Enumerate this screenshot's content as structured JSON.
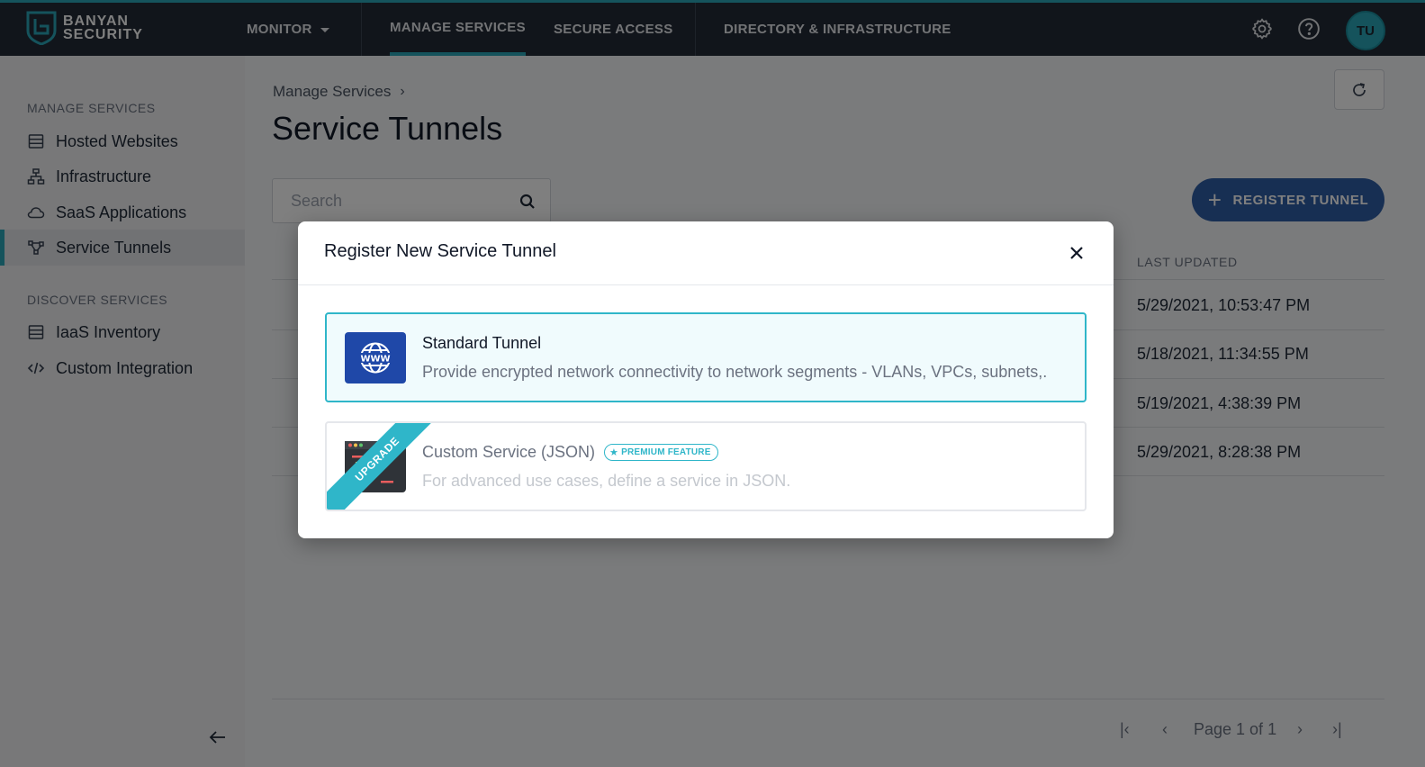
{
  "brand": {
    "line1": "BANYAN",
    "line2": "SECURITY",
    "accent": "#2aa7b8",
    "nav_bg": "#222b36"
  },
  "topnav": {
    "monitor": "MONITOR",
    "manage_services": "MANAGE SERVICES",
    "secure_access": "SECURE ACCESS",
    "directory": "DIRECTORY & INFRASTRUCTURE",
    "settings_icon": "gear-icon",
    "help_icon": "help-circle-icon",
    "avatar_initials": "TU"
  },
  "sidebar": {
    "manage_heading": "MANAGE SERVICES",
    "manage_items": [
      {
        "label": "Hosted Websites",
        "icon": "server-list-icon"
      },
      {
        "label": "Infrastructure",
        "icon": "network-icon"
      },
      {
        "label": "SaaS Applications",
        "icon": "cloud-icon"
      },
      {
        "label": "Service Tunnels",
        "icon": "tunnel-icon",
        "active": true
      }
    ],
    "discover_heading": "DISCOVER SERVICES",
    "discover_items": [
      {
        "label": "IaaS Inventory",
        "icon": "server-list-icon"
      },
      {
        "label": "Custom Integration",
        "icon": "code-icon"
      }
    ]
  },
  "main": {
    "breadcrumb": "Manage Services",
    "breadcrumb_sep": "›",
    "title": "Service Tunnels",
    "search_placeholder": "Search",
    "register_button": "REGISTER TUNNEL",
    "register_button_color": "#2f5ea6",
    "table": {
      "last_updated_header": "LAST UPDATED",
      "rows": [
        {
          "last_updated": "5/29/2021, 10:53:47 PM"
        },
        {
          "last_updated": "5/18/2021, 11:34:55 PM"
        },
        {
          "last_updated": "5/19/2021, 4:38:39 PM"
        },
        {
          "last_updated": "5/29/2021, 8:28:38 PM"
        }
      ]
    },
    "pagination": {
      "text": "Page 1 of 1",
      "first": "|‹",
      "prev": "‹",
      "next": "›",
      "last": "›|"
    }
  },
  "modal": {
    "title": "Register New Service Tunnel",
    "options": [
      {
        "title": "Standard Tunnel",
        "description": "Provide encrypted network connectivity to network segments - VLANs, VPCs, subnets,.",
        "icon": "www-globe-icon",
        "selected": true
      },
      {
        "title": "Custom Service (JSON)",
        "description": "For advanced use cases, define a service in JSON.",
        "badge": "PREMIUM FEATURE",
        "ribbon": "UPGRADE",
        "icon": "code-window-icon",
        "disabled": true
      }
    ]
  }
}
